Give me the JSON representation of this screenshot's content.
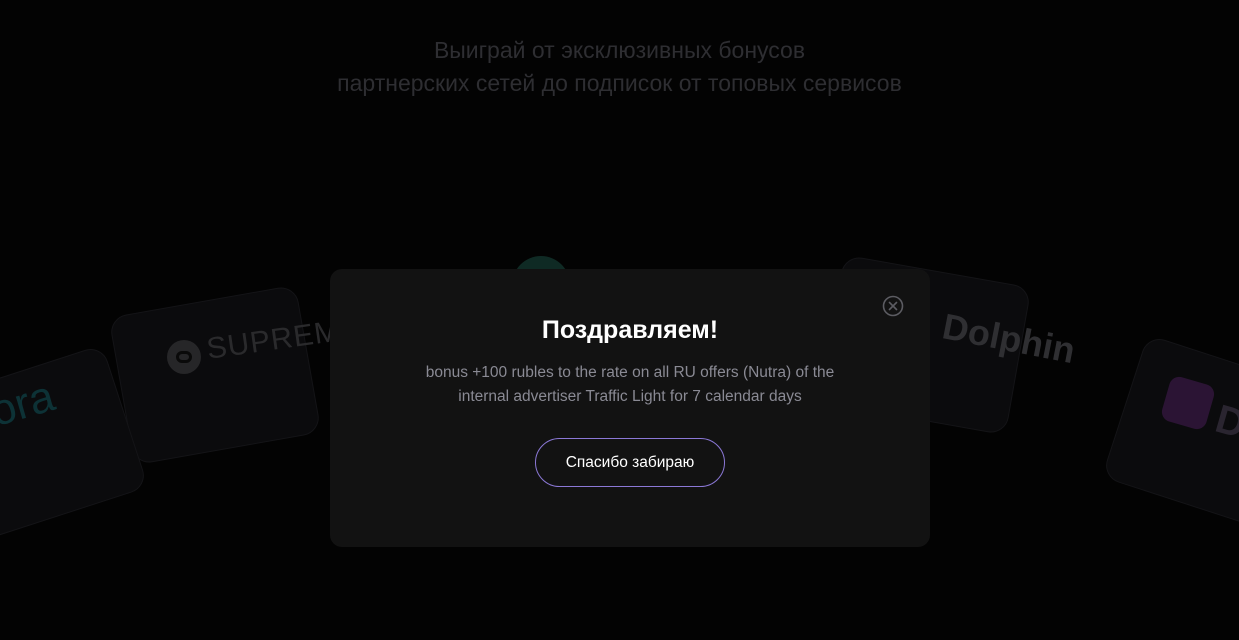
{
  "background": {
    "headline_line1": "Выиграй от эксклюзивных бонусов",
    "headline_line2": "партнерских сетей до подписок от топовых сервисов",
    "brands": {
      "left_partial": "ora",
      "supreme": "SUPREME",
      "dolphin": "Dolphin",
      "right_partial": "D"
    }
  },
  "modal": {
    "title": "Поздравляем!",
    "description": "bonus +100 rubles to the rate on all RU offers (Nutra) of the internal advertiser Traffic Light for 7 calendar days",
    "cta_label": "Спасибо забираю",
    "close_icon": "close-circle-icon"
  },
  "colors": {
    "background": "#030303",
    "modal_bg": "#121212",
    "title": "#ffffff",
    "description": "#8a8a94",
    "button_border": "#8b78d6"
  }
}
